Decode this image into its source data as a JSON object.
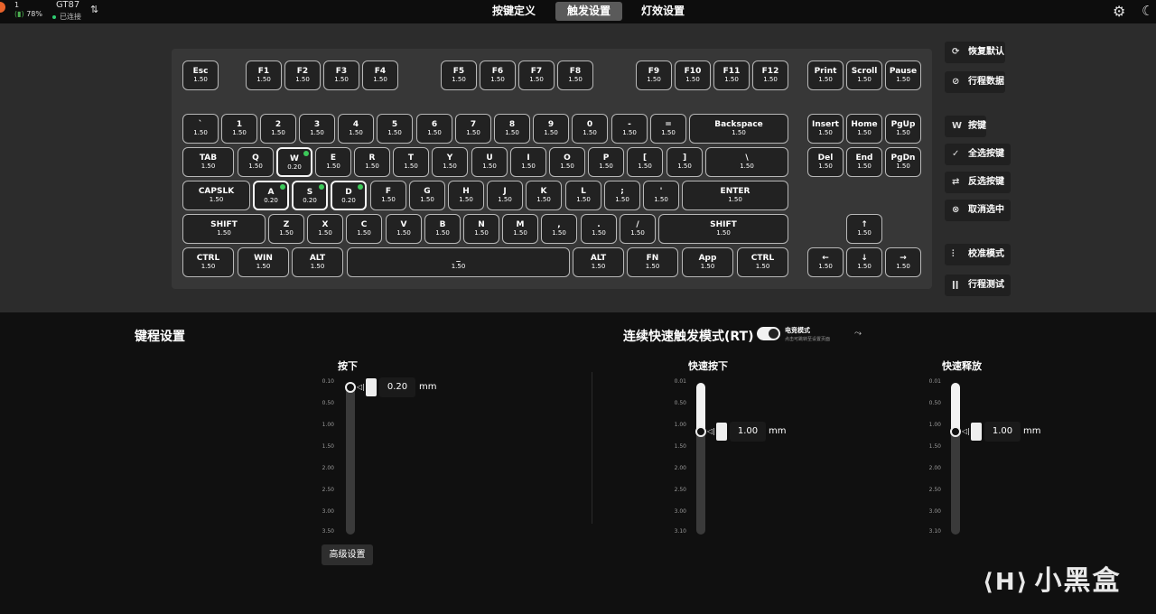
{
  "topbar": {
    "battery_icon_label": "1",
    "battery_pct": "78%",
    "device_name": "GT87",
    "device_status": "已连接",
    "tabs": [
      {
        "label": "按键定义",
        "active": false
      },
      {
        "label": "触发设置",
        "active": true
      },
      {
        "label": "灯效设置",
        "active": false
      }
    ]
  },
  "keys": [
    {
      "label": "Esc",
      "value": "1.50"
    },
    {
      "label": "F1",
      "value": "1.50"
    },
    {
      "label": "F2",
      "value": "1.50"
    },
    {
      "label": "F3",
      "value": "1.50"
    },
    {
      "label": "F4",
      "value": "1.50"
    },
    {
      "label": "F5",
      "value": "1.50"
    },
    {
      "label": "F6",
      "value": "1.50"
    },
    {
      "label": "F7",
      "value": "1.50"
    },
    {
      "label": "F8",
      "value": "1.50"
    },
    {
      "label": "F9",
      "value": "1.50"
    },
    {
      "label": "F10",
      "value": "1.50"
    },
    {
      "label": "F11",
      "value": "1.50"
    },
    {
      "label": "F12",
      "value": "1.50"
    },
    {
      "label": "Print",
      "value": "1.50"
    },
    {
      "label": "Scroll",
      "value": "1.50"
    },
    {
      "label": "Pause",
      "value": "1.50"
    },
    {
      "label": "`",
      "value": "1.50"
    },
    {
      "label": "1",
      "value": "1.50"
    },
    {
      "label": "2",
      "value": "1.50"
    },
    {
      "label": "3",
      "value": "1.50"
    },
    {
      "label": "4",
      "value": "1.50"
    },
    {
      "label": "5",
      "value": "1.50"
    },
    {
      "label": "6",
      "value": "1.50"
    },
    {
      "label": "7",
      "value": "1.50"
    },
    {
      "label": "8",
      "value": "1.50"
    },
    {
      "label": "9",
      "value": "1.50"
    },
    {
      "label": "0",
      "value": "1.50"
    },
    {
      "label": "-",
      "value": "1.50"
    },
    {
      "label": "=",
      "value": "1.50"
    },
    {
      "label": "Backspace",
      "value": "1.50"
    },
    {
      "label": "Insert",
      "value": "1.50"
    },
    {
      "label": "Home",
      "value": "1.50"
    },
    {
      "label": "PgUp",
      "value": "1.50"
    },
    {
      "label": "TAB",
      "value": "1.50"
    },
    {
      "label": "Q",
      "value": "1.50"
    },
    {
      "label": "W",
      "value": "0.20",
      "selected": true
    },
    {
      "label": "E",
      "value": "1.50"
    },
    {
      "label": "R",
      "value": "1.50"
    },
    {
      "label": "T",
      "value": "1.50"
    },
    {
      "label": "Y",
      "value": "1.50"
    },
    {
      "label": "U",
      "value": "1.50"
    },
    {
      "label": "I",
      "value": "1.50"
    },
    {
      "label": "O",
      "value": "1.50"
    },
    {
      "label": "P",
      "value": "1.50"
    },
    {
      "label": "[",
      "value": "1.50"
    },
    {
      "label": "]",
      "value": "1.50"
    },
    {
      "label": "\\",
      "value": "1.50"
    },
    {
      "label": "Del",
      "value": "1.50"
    },
    {
      "label": "End",
      "value": "1.50"
    },
    {
      "label": "PgDn",
      "value": "1.50"
    },
    {
      "label": "CAPSLK",
      "value": "1.50"
    },
    {
      "label": "A",
      "value": "0.20",
      "selected": true
    },
    {
      "label": "S",
      "value": "0.20",
      "selected": true
    },
    {
      "label": "D",
      "value": "0.20",
      "selected": true
    },
    {
      "label": "F",
      "value": "1.50"
    },
    {
      "label": "G",
      "value": "1.50"
    },
    {
      "label": "H",
      "value": "1.50"
    },
    {
      "label": "J",
      "value": "1.50"
    },
    {
      "label": "K",
      "value": "1.50"
    },
    {
      "label": "L",
      "value": "1.50"
    },
    {
      "label": ";",
      "value": "1.50"
    },
    {
      "label": "'",
      "value": "1.50"
    },
    {
      "label": "ENTER",
      "value": "1.50"
    },
    {
      "label": "SHIFT",
      "value": "1.50"
    },
    {
      "label": "Z",
      "value": "1.50"
    },
    {
      "label": "X",
      "value": "1.50"
    },
    {
      "label": "C",
      "value": "1.50"
    },
    {
      "label": "V",
      "value": "1.50"
    },
    {
      "label": "B",
      "value": "1.50"
    },
    {
      "label": "N",
      "value": "1.50"
    },
    {
      "label": "M",
      "value": "1.50"
    },
    {
      "label": ",",
      "value": "1.50"
    },
    {
      "label": ".",
      "value": "1.50"
    },
    {
      "label": "/",
      "value": "1.50"
    },
    {
      "label": "SHIFT",
      "value": "1.50"
    },
    {
      "label": "↑",
      "value": "1.50"
    },
    {
      "label": "CTRL",
      "value": "1.50"
    },
    {
      "label": "WIN",
      "value": "1.50"
    },
    {
      "label": "ALT",
      "value": "1.50"
    },
    {
      "label": "_",
      "value": "1.50"
    },
    {
      "label": "ALT",
      "value": "1.50"
    },
    {
      "label": "FN",
      "value": "1.50"
    },
    {
      "label": "App",
      "value": "1.50"
    },
    {
      "label": "CTRL",
      "value": "1.50"
    },
    {
      "label": "←",
      "value": "1.50"
    },
    {
      "label": "↓",
      "value": "1.50"
    },
    {
      "label": "→",
      "value": "1.50"
    }
  ],
  "side_buttons": [
    {
      "label": "恢复默认",
      "icon": "reset-icon"
    },
    {
      "label": "行程数据",
      "icon": "eye-off-icon"
    },
    {
      "label": "按键",
      "icon": "wasd-icon"
    },
    {
      "label": "全选按键",
      "icon": "check-circle-icon"
    },
    {
      "label": "反选按键",
      "icon": "invert-icon"
    },
    {
      "label": "取消选中",
      "icon": "x-circle-icon"
    },
    {
      "label": "校准模式",
      "icon": "sliders-icon"
    },
    {
      "label": "行程测试",
      "icon": "bars-icon"
    }
  ],
  "travel": {
    "title": "键程设置",
    "press_label": "按下",
    "press_value": "0.20",
    "press_fraction": 0.03,
    "unit": "mm",
    "ticks": [
      "0.10",
      "0.50",
      "1.00",
      "1.50",
      "2.00",
      "2.50",
      "3.00",
      "3.50"
    ],
    "advanced_label": "高级设置"
  },
  "rt": {
    "title": "连续快速触发模式(RT)",
    "toggle_on": true,
    "esports_label": "电竞模式",
    "esports_hint": "点击可跳转至设置页面",
    "fast_press_label": "快速按下",
    "fast_press_value": "1.00",
    "fast_release_label": "快速释放",
    "fast_release_value": "1.00",
    "value_fraction": 0.32,
    "unit": "mm",
    "ticks": [
      "0.01",
      "0.50",
      "1.00",
      "1.50",
      "2.00",
      "2.50",
      "3.00",
      "3.10"
    ]
  },
  "watermark": "小黑盒"
}
